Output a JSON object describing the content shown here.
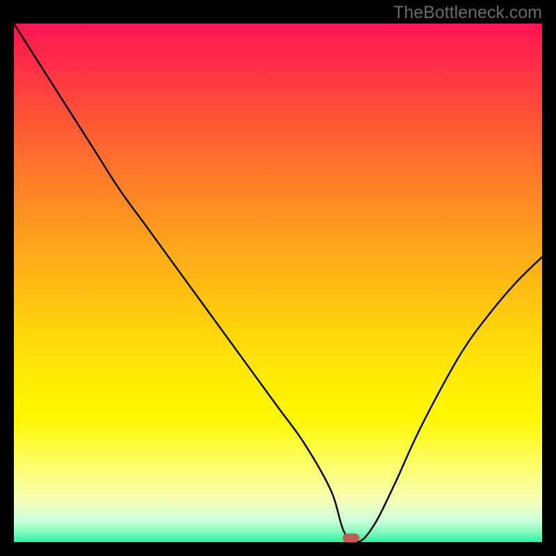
{
  "watermark": "TheBottleneck.com",
  "chart_data": {
    "type": "line",
    "title": "",
    "xlabel": "",
    "ylabel": "",
    "x": [
      0.0,
      0.05,
      0.1,
      0.15,
      0.2,
      0.25,
      0.3,
      0.35,
      0.4,
      0.45,
      0.5,
      0.55,
      0.6,
      0.625,
      0.65,
      0.68,
      0.72,
      0.76,
      0.8,
      0.85,
      0.9,
      0.95,
      1.0
    ],
    "y": [
      1.0,
      0.92,
      0.84,
      0.76,
      0.68,
      0.61,
      0.54,
      0.47,
      0.4,
      0.33,
      0.26,
      0.19,
      0.1,
      0.02,
      0.0,
      0.03,
      0.11,
      0.2,
      0.28,
      0.37,
      0.44,
      0.5,
      0.55
    ],
    "xlim": [
      0,
      1
    ],
    "ylim": [
      0,
      1
    ],
    "minimum_x": 0.638,
    "minimum_y": 0.0,
    "gradient_background": true
  }
}
